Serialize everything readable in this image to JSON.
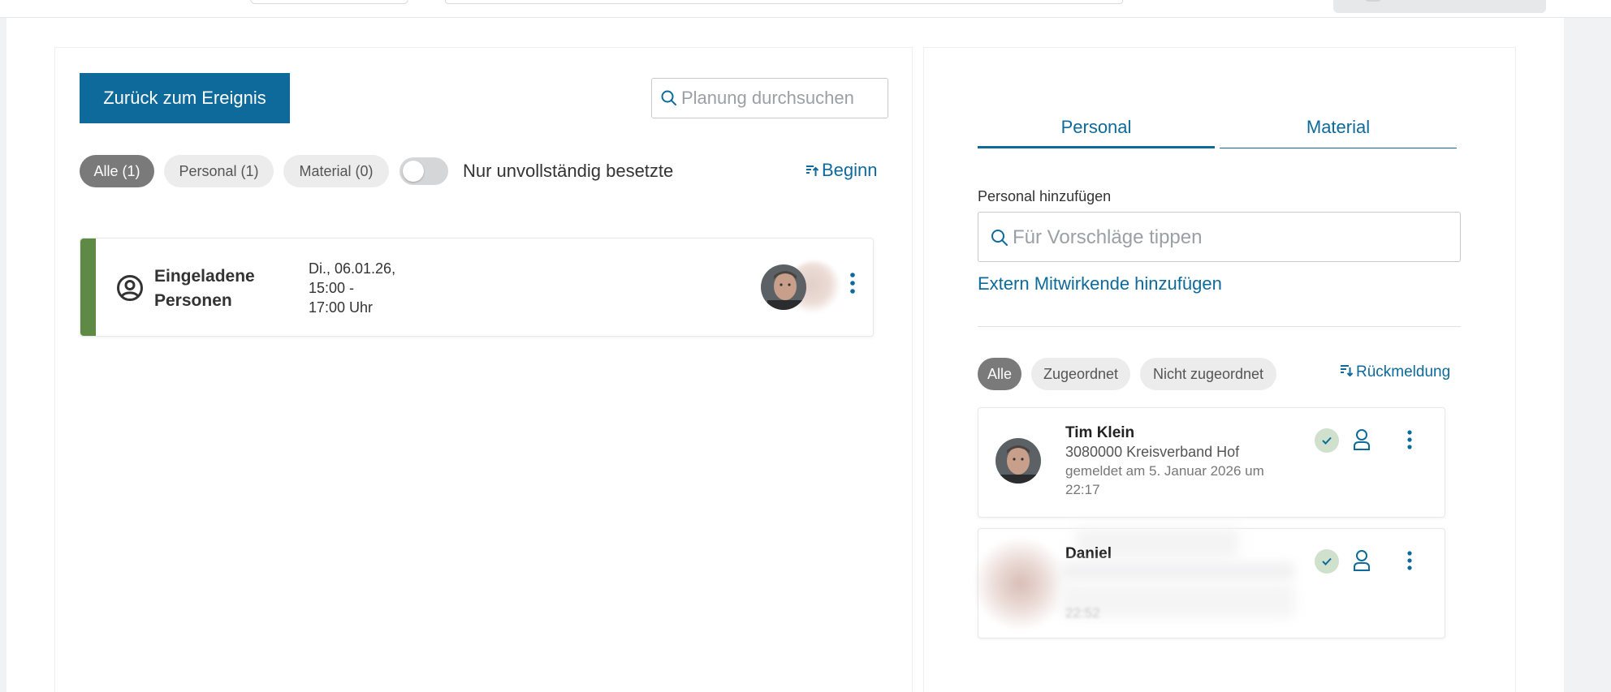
{
  "colors": {
    "primary": "#0d6a9a",
    "event_stripe": "#5f8a45",
    "chip_active": "#7a7a7a",
    "chip": "#ececed",
    "status_ok": "#cfe0cd"
  },
  "left": {
    "back_button": "Zurück zum Ereignis",
    "search_placeholder": "Planung durchsuchen",
    "filters": [
      {
        "label": "Alle (1)",
        "active": true
      },
      {
        "label": "Personal (1)",
        "active": false
      },
      {
        "label": "Material (0)",
        "active": false
      }
    ],
    "toggle_label": "Nur unvollständig besetzte",
    "toggle_on": false,
    "sort_label": "Beginn",
    "sort_icon": "sort-ascending-icon",
    "event": {
      "icon": "user-circle-icon",
      "title_line1": "Eingeladene",
      "title_line2": "Personen",
      "date_line1": "Di., 06.01.26,",
      "date_line2": "15:00 -",
      "date_line3": "17:00 Uhr"
    }
  },
  "right": {
    "tabs": [
      {
        "label": "Personal",
        "active": true
      },
      {
        "label": "Material",
        "active": false
      }
    ],
    "add_label": "Personal hinzufügen",
    "add_placeholder": "Für Vorschläge tippen",
    "extern_link": "Extern Mitwirkende hinzufügen",
    "filters": [
      {
        "label": "Alle",
        "active": true
      },
      {
        "label": "Zugeordnet",
        "active": false
      },
      {
        "label": "Nicht zugeordnet",
        "active": false
      }
    ],
    "sort_label": "Rückmeldung",
    "persons": [
      {
        "name": "Tim Klein",
        "org": "3080000 Kreisverband Hof",
        "meta": "gemeldet am 5. Januar 2026 um 22:17",
        "status": "confirmed"
      },
      {
        "name": "Daniel",
        "meta": "22:52",
        "status": "confirmed"
      }
    ]
  }
}
